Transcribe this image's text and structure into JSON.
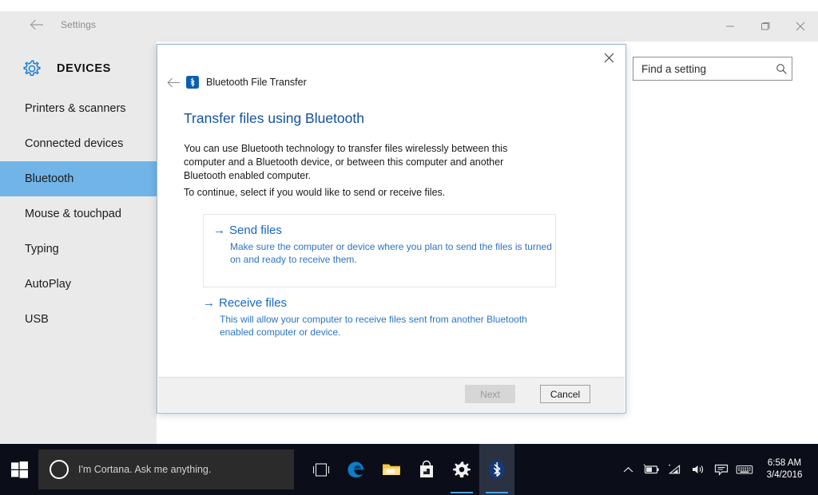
{
  "window": {
    "title": "Settings",
    "back_icon": "back-arrow-icon",
    "controls": {
      "minimize": "minimize-icon",
      "maximize": "maximize-icon",
      "close": "close-icon"
    }
  },
  "sidebar": {
    "category_icon": "gear-icon",
    "category": "DEVICES",
    "items": [
      {
        "label": "Printers & scanners",
        "selected": false
      },
      {
        "label": "Connected devices",
        "selected": false
      },
      {
        "label": "Bluetooth",
        "selected": true
      },
      {
        "label": "Mouse & touchpad",
        "selected": false
      },
      {
        "label": "Typing",
        "selected": false
      },
      {
        "label": "AutoPlay",
        "selected": false
      },
      {
        "label": "USB",
        "selected": false
      }
    ],
    "selected_color": "#71b4e8",
    "background_color": "#eaeaea"
  },
  "search": {
    "placeholder": "Find a setting",
    "value": "Find a setting",
    "icon": "search-icon"
  },
  "dialog": {
    "close_icon": "close-icon",
    "back_icon": "back-arrow-icon",
    "app_icon": "bluetooth-icon",
    "nav_title": "Bluetooth File Transfer",
    "heading": "Transfer files using Bluetooth",
    "paragraph1": "You can use Bluetooth technology to transfer files wirelessly between this computer and a Bluetooth device, or between this computer and another Bluetooth enabled computer.",
    "paragraph2": "To continue, select if you would like to send or receive files.",
    "heading_color": "#12519e",
    "link_color": "#1567c4",
    "options": [
      {
        "arrow": "→",
        "title": "Send files",
        "description": "Make sure the computer or device where you plan to send the files is turned on and ready to receive them.",
        "boxed": true
      },
      {
        "arrow": "→",
        "title": "Receive files",
        "description": "This will allow your computer to receive files sent from another Bluetooth enabled computer or device.",
        "boxed": false
      }
    ],
    "buttons": {
      "next": "Next",
      "next_enabled": false,
      "cancel": "Cancel",
      "cancel_enabled": true
    }
  },
  "taskbar": {
    "start_icon": "windows-logo-icon",
    "cortana": {
      "icon": "cortana-circle-icon",
      "text": "I'm Cortana. Ask me anything."
    },
    "apps": [
      {
        "name": "task-view-icon",
        "running": false,
        "active": false
      },
      {
        "name": "edge-browser-icon",
        "running": false,
        "active": false
      },
      {
        "name": "file-explorer-icon",
        "running": false,
        "active": false
      },
      {
        "name": "microsoft-store-icon",
        "running": false,
        "active": false
      },
      {
        "name": "settings-gear-icon",
        "running": true,
        "active": false
      },
      {
        "name": "bluetooth-icon",
        "running": true,
        "active": true
      }
    ],
    "tray": [
      "show-hidden-icons-icon",
      "battery-icon",
      "wifi-icon",
      "volume-icon",
      "action-center-icon",
      "keyboard-icon"
    ],
    "clock": {
      "time": "6:58 AM",
      "date": "3/4/2016"
    },
    "background_color": "#0b0e18"
  }
}
